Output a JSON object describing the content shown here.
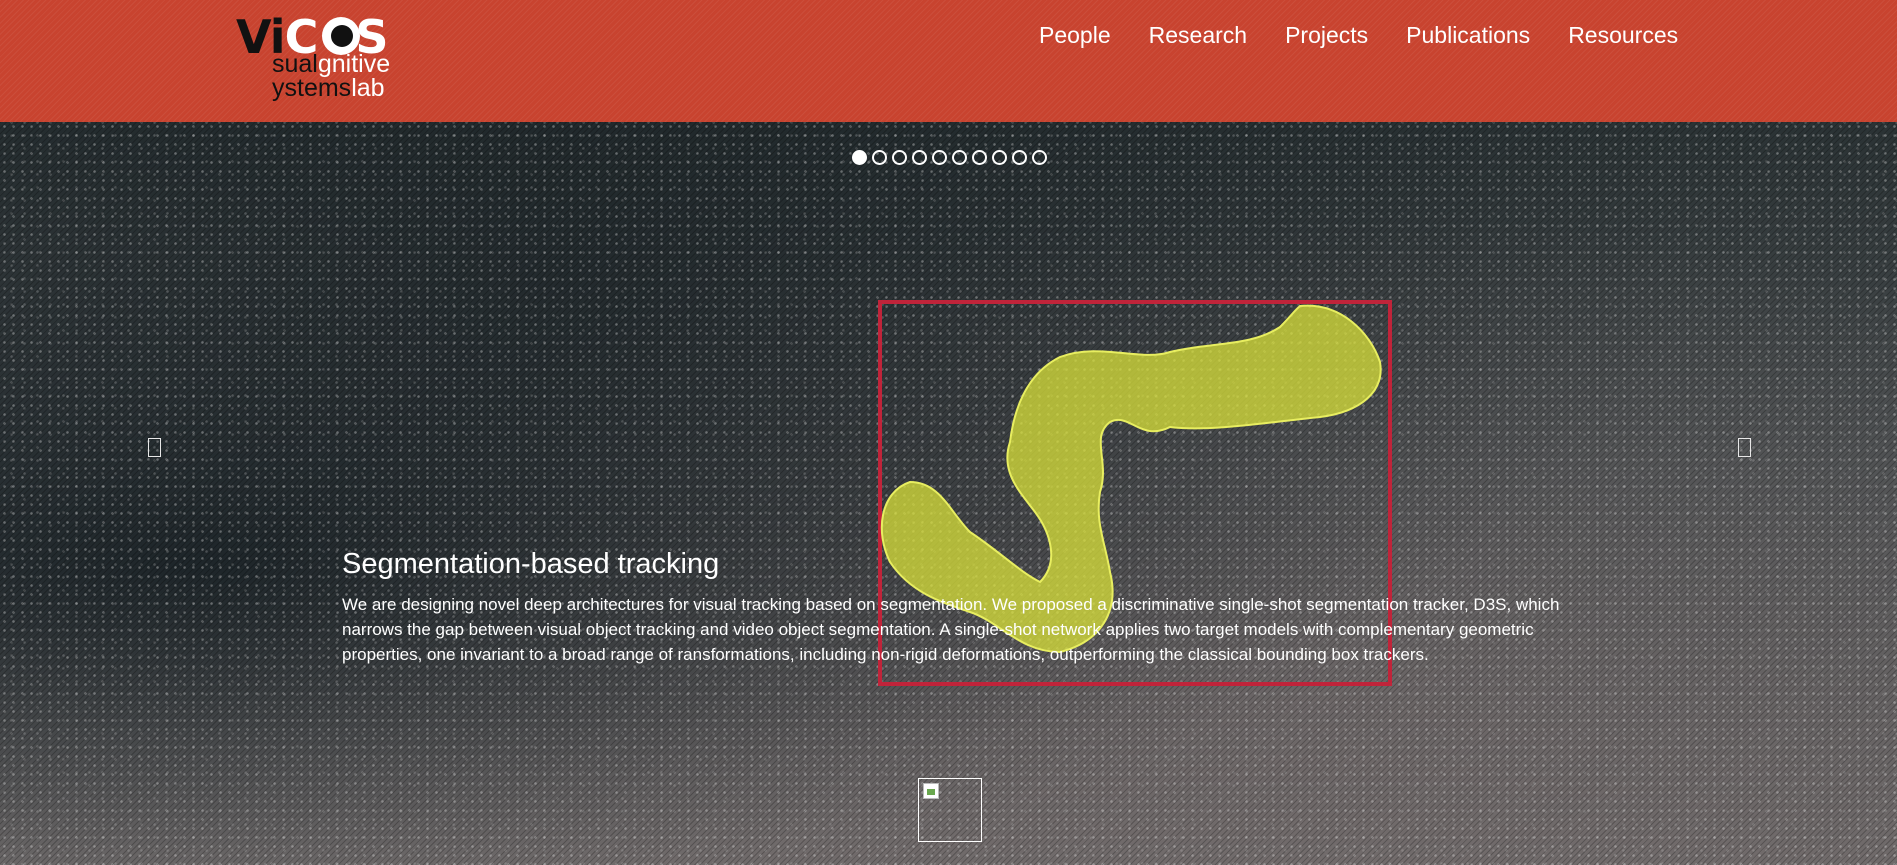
{
  "logo": {
    "main_dark_1": "Vi",
    "main_white_1": "C",
    "main_white_2": "S",
    "line1_dark": "sual",
    "line1_light": "gnitive",
    "line2_dark": "ystems",
    "line2_light": "lab"
  },
  "nav": {
    "items": [
      {
        "label": "People"
      },
      {
        "label": "Research"
      },
      {
        "label": "Projects"
      },
      {
        "label": "Publications"
      },
      {
        "label": "Resources"
      }
    ]
  },
  "carousel": {
    "slide_count": 10,
    "active_index": 0,
    "caption": {
      "title": "Segmentation-based tracking",
      "text": "We are designing novel deep architectures for visual tracking based on segmentation. We proposed a discriminative single-shot segmentation tracker, D3S, which narrows the gap between visual object tracking and video object segmentation. A single-shot network applies two target models with complementary geometric properties, one invariant to a broad range of ransformations, including non-rigid deformations, outperforming the classical bounding box trackers."
    },
    "prev_icon": "chevron-left-icon",
    "next_icon": "chevron-right-icon"
  },
  "colors": {
    "header": "#c8432f",
    "segmentation": "#d9e23a",
    "bbox": "#c0243a"
  }
}
